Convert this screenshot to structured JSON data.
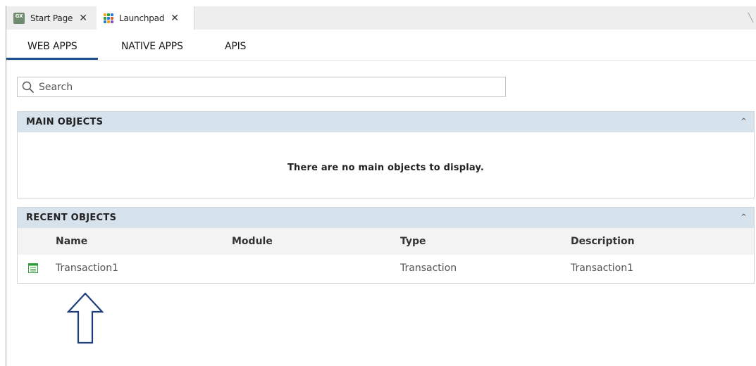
{
  "doc_tabs": [
    {
      "label": "Start Page",
      "icon": "gx-icon",
      "icon_text": "GX"
    },
    {
      "label": "Launchpad",
      "icon": "launchpad-grid-icon",
      "active": true
    }
  ],
  "close_glyph": "✕",
  "nav_tabs": [
    {
      "label": "WEB APPS",
      "active": true
    },
    {
      "label": "NATIVE APPS"
    },
    {
      "label": "APIS"
    }
  ],
  "search": {
    "placeholder": "Search",
    "value": ""
  },
  "main_objects": {
    "title": "MAIN OBJECTS",
    "empty_message": "There are no main objects to display."
  },
  "recent_objects": {
    "title": "RECENT OBJECTS",
    "columns": [
      "Name",
      "Module",
      "Type",
      "Description"
    ],
    "rows": [
      {
        "icon": "transaction-icon",
        "name": "Transaction1",
        "module": "",
        "type": "Transaction",
        "description": "Transaction1"
      }
    ]
  },
  "collapse_glyph": "^",
  "colors": {
    "accent": "#1d4f8c",
    "panel_header_bg": "#d6e2ec",
    "grid_header_bg": "#f3f3f3",
    "arrow": "#1f3f7a"
  }
}
